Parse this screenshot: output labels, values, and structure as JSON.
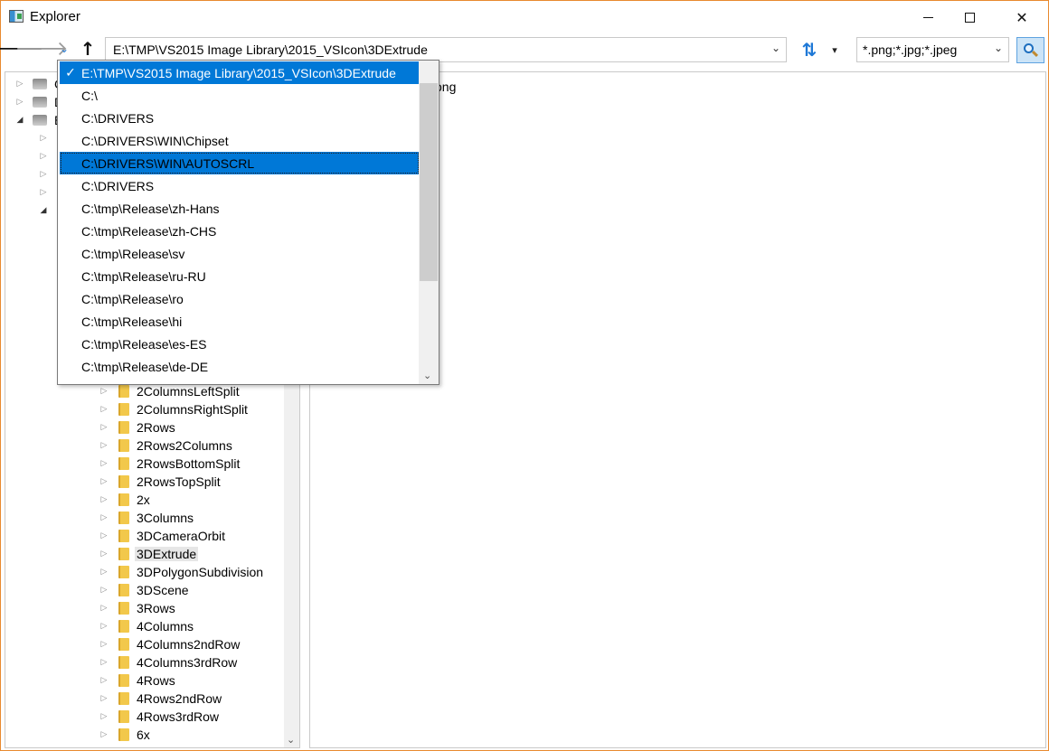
{
  "window": {
    "title": "Explorer",
    "minimize_icon": "minimize-icon",
    "maximize_icon": "maximize-icon",
    "close_glyph": "✕"
  },
  "toolbar": {
    "back_glyph": "🡐",
    "forward_glyph": "🡒",
    "recent_glyph": "⌄",
    "up_glyph": "↑",
    "address_value": "E:\\TMP\\VS2015 Image Library\\2015_VSIcon\\3DExtrude",
    "address_chevron": "⌄",
    "refresh_glyph": "⇅",
    "refresh_menu_glyph": "▾",
    "filter_value": "*.png;*.jpg;*.jpeg",
    "filter_chevron": "⌄",
    "accent_color": "#1e78d6"
  },
  "address_history": {
    "items": [
      {
        "label": "E:\\TMP\\VS2015 Image Library\\2015_VSIcon\\3DExtrude",
        "checked": true,
        "state": "current"
      },
      {
        "label": "C:\\",
        "checked": false,
        "state": "normal"
      },
      {
        "label": "C:\\DRIVERS",
        "checked": false,
        "state": "normal"
      },
      {
        "label": "C:\\DRIVERS\\WIN\\Chipset",
        "checked": false,
        "state": "normal"
      },
      {
        "label": "C:\\DRIVERS\\WIN\\AUTOSCRL",
        "checked": false,
        "state": "hover"
      },
      {
        "label": "C:\\DRIVERS",
        "checked": false,
        "state": "normal"
      },
      {
        "label": "C:\\tmp\\Release\\zh-Hans",
        "checked": false,
        "state": "normal"
      },
      {
        "label": "C:\\tmp\\Release\\zh-CHS",
        "checked": false,
        "state": "normal"
      },
      {
        "label": "C:\\tmp\\Release\\sv",
        "checked": false,
        "state": "normal"
      },
      {
        "label": "C:\\tmp\\Release\\ru-RU",
        "checked": false,
        "state": "normal"
      },
      {
        "label": "C:\\tmp\\Release\\ro",
        "checked": false,
        "state": "normal"
      },
      {
        "label": "C:\\tmp\\Release\\hi",
        "checked": false,
        "state": "normal"
      },
      {
        "label": "C:\\tmp\\Release\\es-ES",
        "checked": false,
        "state": "normal"
      },
      {
        "label": "C:\\tmp\\Release\\de-DE",
        "checked": false,
        "state": "normal"
      }
    ],
    "check_glyph": "✓",
    "scroll_down_glyph": "⌄",
    "selection_color": "#0078d7"
  },
  "tree": {
    "visible_drive_letters": [
      "C",
      "D",
      "E"
    ],
    "folders": [
      {
        "label": "2ColumnsLeftSplit",
        "selected": false
      },
      {
        "label": "2ColumnsRightSplit",
        "selected": false
      },
      {
        "label": "2Rows",
        "selected": false
      },
      {
        "label": "2Rows2Columns",
        "selected": false
      },
      {
        "label": "2RowsBottomSplit",
        "selected": false
      },
      {
        "label": "2RowsTopSplit",
        "selected": false
      },
      {
        "label": "2x",
        "selected": false
      },
      {
        "label": "3Columns",
        "selected": false
      },
      {
        "label": "3DCameraOrbit",
        "selected": false
      },
      {
        "label": "3DExtrude",
        "selected": true
      },
      {
        "label": "3DPolygonSubdivision",
        "selected": false
      },
      {
        "label": "3DScene",
        "selected": false
      },
      {
        "label": "3Rows",
        "selected": false
      },
      {
        "label": "4Columns",
        "selected": false
      },
      {
        "label": "4Columns2ndRow",
        "selected": false
      },
      {
        "label": "4Columns3rdRow",
        "selected": false
      },
      {
        "label": "4Rows",
        "selected": false
      },
      {
        "label": "4Rows2ndRow",
        "selected": false
      },
      {
        "label": "4Rows3rdRow",
        "selected": false
      },
      {
        "label": "6x",
        "selected": false
      }
    ],
    "expander_collapsed": "▷",
    "expander_open": "◢",
    "scroll_down_glyph": "⌄",
    "folder_color": "#f2c84b"
  },
  "content": {
    "visible_text": "ong"
  }
}
